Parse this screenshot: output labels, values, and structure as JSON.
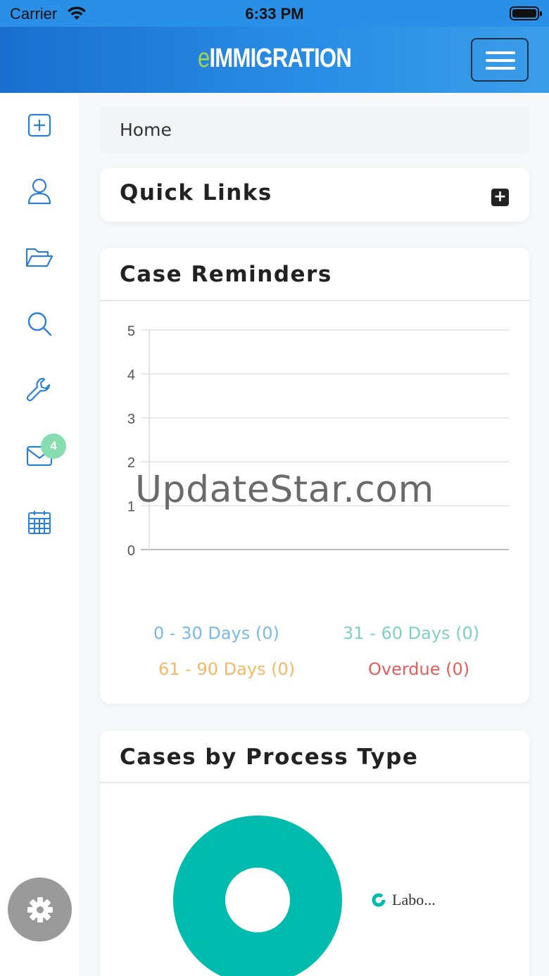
{
  "status_bar": {
    "carrier": "Carrier",
    "time": "6:33 PM"
  },
  "navbar": {
    "brand_e": "e",
    "brand_rest": "IMMIGRATION",
    "menu_icon": "hamburger-icon"
  },
  "sidebar": {
    "items": [
      {
        "name": "add",
        "icon": "plus-square-icon"
      },
      {
        "name": "profile",
        "icon": "user-icon"
      },
      {
        "name": "cases",
        "icon": "folder-open-icon"
      },
      {
        "name": "search",
        "icon": "search-icon"
      },
      {
        "name": "tools",
        "icon": "wrench-icon"
      },
      {
        "name": "messages",
        "icon": "envelope-icon"
      },
      {
        "name": "calendar",
        "icon": "calendar-icon"
      }
    ],
    "messages_badge": "4",
    "settings_icon": "gear-icon"
  },
  "breadcrumb": {
    "home": "Home"
  },
  "quick_links": {
    "title": "Quick Links"
  },
  "case_reminders": {
    "title": "Case Reminders",
    "legend": [
      {
        "label": "0 - 30 Days (0)",
        "color": "#7ab8e6"
      },
      {
        "label": "31 - 60 Days (0)",
        "color": "#7fcfc4"
      },
      {
        "label": "61 - 90 Days (0)",
        "color": "#f3b866"
      },
      {
        "label": "Overdue (0)",
        "color": "#e85c5c"
      }
    ]
  },
  "chart_data": {
    "type": "bar",
    "categories": [
      "0 - 30 Days",
      "31 - 60 Days",
      "61 - 90 Days",
      "Overdue"
    ],
    "values": [
      0,
      0,
      0,
      0
    ],
    "ylim": [
      0,
      5
    ],
    "yticks": [
      "0",
      "1",
      "2",
      "3",
      "4",
      "5"
    ],
    "grid": true,
    "legend_position": "bottom"
  },
  "cases_by_process": {
    "title": "Cases by Process Type",
    "legend_label": "Labo...",
    "color": "#00bcaf"
  },
  "watermark": "UpdateStar.com"
}
